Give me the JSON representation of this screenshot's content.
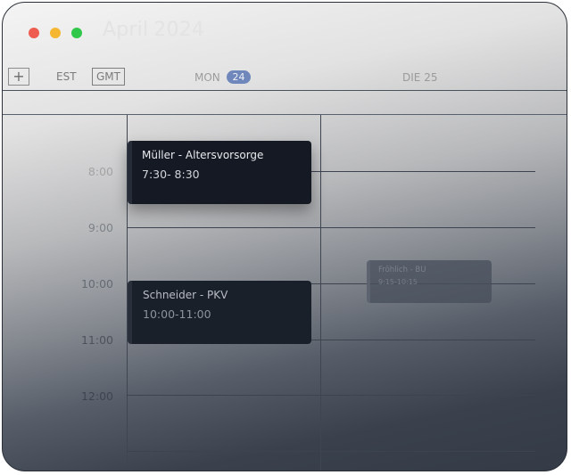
{
  "window": {
    "title_month": "April",
    "title_year": "2024"
  },
  "header": {
    "add_label": "+",
    "timezones": [
      "EST",
      "GMT"
    ],
    "days": [
      {
        "name": "MON",
        "date": "24",
        "today": true
      },
      {
        "name": "DIE",
        "date": "25",
        "today": false
      }
    ]
  },
  "time_labels": [
    "8:00",
    "9:00",
    "10:00",
    "11:00",
    "12:00"
  ],
  "events": [
    {
      "title": "Müller - Altersvorsorge",
      "time": "7:30- 8:30",
      "day": "MON"
    },
    {
      "title": "Schneider - PKV",
      "time": "10:00-11:00",
      "day": "MON"
    },
    {
      "title": "Fröhlich - BU",
      "time": "9:15-10:15",
      "day": "DIE"
    }
  ],
  "colors": {
    "traffic_red": "#ee5b51",
    "traffic_yellow": "#f5b731",
    "traffic_green": "#2fc84a",
    "today_badge": "#6f87ba",
    "event_bg": "#141923"
  }
}
